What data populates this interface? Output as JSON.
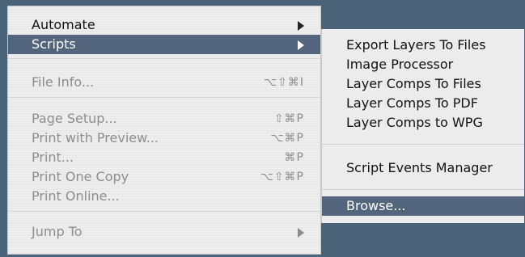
{
  "menu": {
    "items": [
      {
        "label": "Automate",
        "enabled": true,
        "has_submenu": true
      },
      {
        "label": "Scripts",
        "enabled": true,
        "has_submenu": true,
        "selected": true
      },
      {
        "label": "File Info...",
        "enabled": false,
        "shortcut": "⌥⇧⌘I"
      },
      {
        "label": "Page Setup...",
        "enabled": false,
        "shortcut": "⇧⌘P"
      },
      {
        "label": "Print with Preview...",
        "enabled": false,
        "shortcut": "⌥⌘P"
      },
      {
        "label": "Print...",
        "enabled": false,
        "shortcut": "⌘P"
      },
      {
        "label": "Print One Copy",
        "enabled": false,
        "shortcut": "⌥⇧⌘P"
      },
      {
        "label": "Print Online...",
        "enabled": false
      },
      {
        "label": "Jump To",
        "enabled": false,
        "has_submenu": true
      }
    ]
  },
  "submenu": {
    "items": [
      {
        "label": "Export Layers To Files"
      },
      {
        "label": "Image Processor"
      },
      {
        "label": "Layer Comps To Files"
      },
      {
        "label": "Layer Comps To PDF"
      },
      {
        "label": "Layer Comps to WPG"
      },
      {
        "label": "Script Events Manager"
      },
      {
        "label": "Browse...",
        "selected": true
      }
    ]
  },
  "colors": {
    "menu_background": "#eeeeee",
    "highlight": "#52657d",
    "desktop": "#4b6378",
    "disabled_text": "#8d8d8d"
  }
}
